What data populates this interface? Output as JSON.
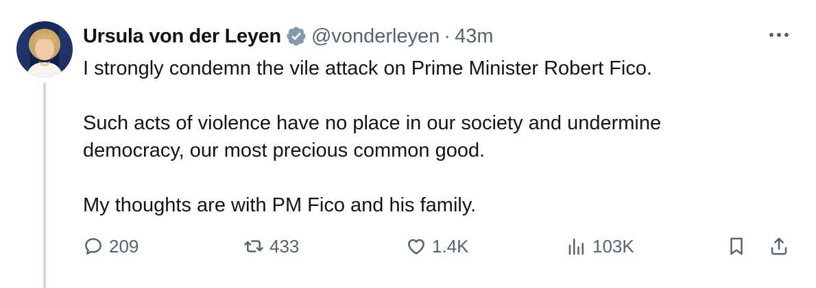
{
  "author": {
    "name": "Ursula von der Leyen",
    "handle": "@vonderleyen",
    "separator": "·",
    "time": "43m",
    "verified_badge_color": "#829aab"
  },
  "tweet": {
    "paragraphs": [
      "I strongly condemn the vile attack on Prime Minister Robert Fico.",
      "Such acts of violence have no place in our society and undermine",
      "democracy, our most precious common good.",
      "My thoughts are with PM Fico and his family."
    ]
  },
  "actions": {
    "reply": {
      "icon": "reply-icon",
      "count": "209"
    },
    "retweet": {
      "icon": "retweet-icon",
      "count": "433"
    },
    "like": {
      "icon": "heart-icon",
      "count": "1.4K"
    },
    "views": {
      "icon": "views-icon",
      "count": "103K"
    },
    "bookmark": {
      "icon": "bookmark-icon"
    },
    "share": {
      "icon": "share-icon"
    }
  },
  "colors": {
    "text": "#0f1419",
    "secondary": "#536471",
    "thread_line": "#cfd9de"
  }
}
